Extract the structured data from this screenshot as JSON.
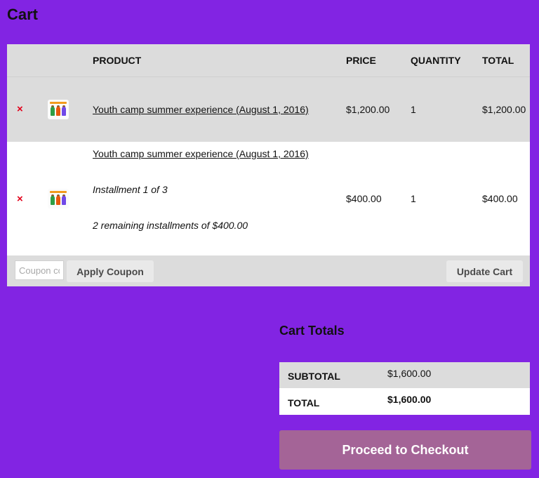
{
  "page": {
    "title": "Cart"
  },
  "table": {
    "headers": {
      "product": "PRODUCT",
      "price": "PRICE",
      "quantity": "QUANTITY",
      "total": "TOTAL"
    },
    "items": [
      {
        "remove_icon": "×",
        "thumbnail": "summer-camp-thumbnail",
        "name": "Youth camp summer experience (August 1, 2016)",
        "price": "$1,200.00",
        "quantity": "1",
        "total": "$1,200.00"
      },
      {
        "remove_icon": "×",
        "thumbnail": "summer-camp-thumbnail",
        "name": "Youth camp summer experience (August 1, 2016)",
        "installment": "Installment 1 of 3",
        "remaining": "2 remaining installments of $400.00",
        "price": "$400.00",
        "quantity": "1",
        "total": "$400.00"
      }
    ]
  },
  "coupon": {
    "placeholder": "Coupon code",
    "apply_label": "Apply Coupon"
  },
  "update_label": "Update Cart",
  "totals": {
    "title": "Cart Totals",
    "subtotal_label": "SUBTOTAL",
    "subtotal_value": "$1,600.00",
    "total_label": "TOTAL",
    "total_value": "$1,600.00"
  },
  "checkout_label": "Proceed to Checkout",
  "colors": {
    "background": "#8224e3",
    "checkout_button": "#a46497",
    "remove_icon": "#e2001a"
  }
}
